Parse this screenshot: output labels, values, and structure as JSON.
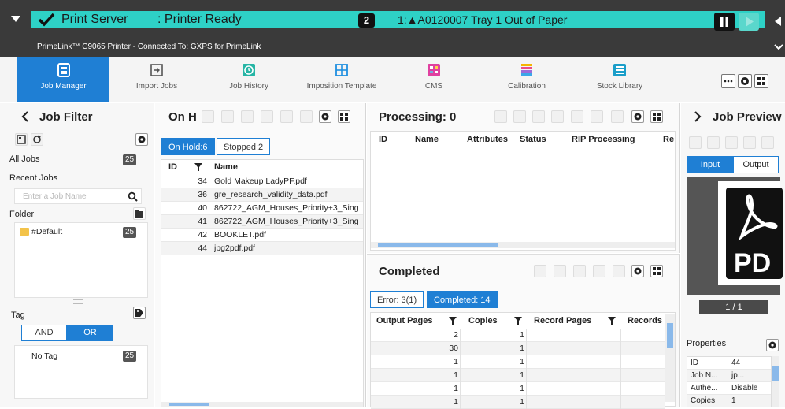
{
  "header": {
    "app_title": "Print Server",
    "printer_status": ": Printer Ready",
    "alert_count": "2",
    "alert_message": "1:▲A0120007 Tray 1 Out of Paper",
    "subtitle": "PrimeLink™ C9065 Printer - Connected To: GXPS for PrimeLink"
  },
  "toolbar": {
    "items": [
      {
        "label": "Job Manager",
        "icon": "job-manager-icon"
      },
      {
        "label": "Import Jobs",
        "icon": "import-icon"
      },
      {
        "label": "Job History",
        "icon": "history-icon"
      },
      {
        "label": "Imposition Template",
        "icon": "grid-icon"
      },
      {
        "label": "CMS",
        "icon": "cms-icon"
      },
      {
        "label": "Calibration",
        "icon": "calibration-icon"
      },
      {
        "label": "Stock Library",
        "icon": "stock-icon"
      }
    ]
  },
  "filter": {
    "title": "Job Filter",
    "all_jobs_label": "All Jobs",
    "all_jobs_count": "25",
    "recent_jobs_label": "Recent Jobs",
    "search_placeholder": "Enter a Job Name",
    "folder_label": "Folder",
    "folder_item": "#Default",
    "folder_count": "25",
    "tag_label": "Tag",
    "and_label": "AND",
    "or_label": "OR",
    "no_tag_label": "No Tag",
    "no_tag_count": "25"
  },
  "onhold": {
    "title": "On H",
    "tab_onhold": "On Hold:6",
    "tab_stopped": "Stopped:2",
    "col_id": "ID",
    "col_name": "Name",
    "rows": [
      {
        "id": "34",
        "name": "Gold Makeup LadyPF.pdf"
      },
      {
        "id": "36",
        "name": "gre_research_validity_data.pdf"
      },
      {
        "id": "40",
        "name": "862722_AGM_Houses_Priority+3_Sing"
      },
      {
        "id": "41",
        "name": "862722_AGM_Houses_Priority+3_Sing"
      },
      {
        "id": "42",
        "name": "BOOKLET.pdf"
      },
      {
        "id": "44",
        "name": "jpg2pdf.pdf"
      }
    ]
  },
  "processing": {
    "title": "Processing: 0",
    "cols": [
      "ID",
      "Name",
      "Attributes",
      "Status",
      "RIP Processing",
      "Re"
    ]
  },
  "completed": {
    "title": "Completed",
    "tab_error": "Error: 3(1)",
    "tab_completed": "Completed: 14",
    "cols": [
      "Output Pages",
      "Copies",
      "Record Pages",
      "Records"
    ],
    "rows": [
      {
        "pages": "2",
        "copies": "1"
      },
      {
        "pages": "30",
        "copies": "1"
      },
      {
        "pages": "1",
        "copies": "1"
      },
      {
        "pages": "1",
        "copies": "1"
      },
      {
        "pages": "1",
        "copies": "1"
      },
      {
        "pages": "1",
        "copies": "1"
      }
    ]
  },
  "preview": {
    "title": "Job Preview",
    "tab_input": "Input",
    "tab_output": "Output",
    "pdf_text": "PD",
    "page_indicator": "1 / 1",
    "properties_label": "Properties",
    "props": [
      {
        "key": "ID",
        "value": "44"
      },
      {
        "key": "Job N...",
        "value": "jp..."
      },
      {
        "key": "Authe...",
        "value": "Disable"
      },
      {
        "key": "Copies",
        "value": "1"
      }
    ]
  },
  "colors": {
    "status_bar": "#2ed1c6",
    "accent": "#1f7fd4",
    "header_dark": "#3a3a3a"
  }
}
